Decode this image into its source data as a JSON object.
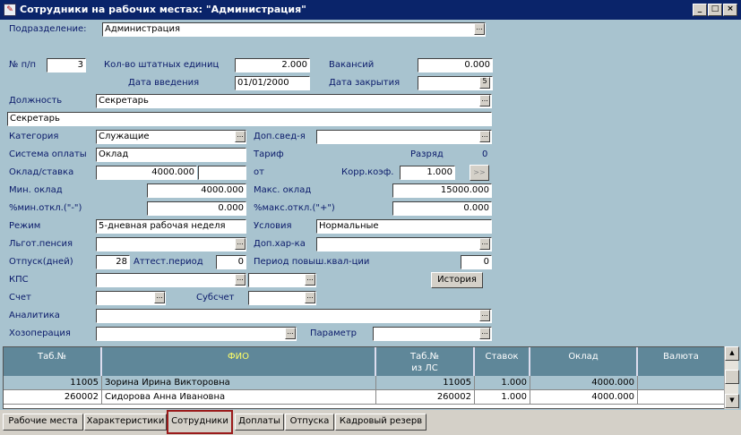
{
  "window": {
    "title": "Сотрудники на рабочих местах: \"Администрация\"",
    "icon": "app-icon",
    "min": "_",
    "max": "□",
    "close": "×"
  },
  "form": {
    "podrazdelenie": {
      "label": "Подразделение:",
      "value": "Администрация"
    },
    "num": {
      "label": "№ п/п",
      "value": "3"
    },
    "shtat": {
      "label": "Кол-во штатных единиц",
      "value": "2.000"
    },
    "vakansiy": {
      "label": "Вакансий",
      "value": "0.000"
    },
    "data_vvedeniya": {
      "label": "Дата введения",
      "value": "01/01/2000"
    },
    "data_zakrytiya": {
      "label": "Дата закрытия",
      "value": ""
    },
    "dolzhnost": {
      "label": "Должность",
      "value": "Секретарь",
      "full": "Секретарь"
    },
    "kategoriya": {
      "label": "Категория",
      "value": "Служащие"
    },
    "dop_sved": {
      "label": "Доп.свед-я",
      "value": ""
    },
    "sistema_oplaty": {
      "label": "Система оплаты",
      "value": "Оклад"
    },
    "tarif": {
      "label": "Тариф"
    },
    "razryad": {
      "label": "Разряд",
      "value": "0"
    },
    "oklad_stavka": {
      "label": "Оклад/ставка",
      "value": "4000.000",
      "value2": ""
    },
    "ot": {
      "label": "от"
    },
    "korr": {
      "label": "Корр.коэф.",
      "value": "1.000",
      "btn": ">>"
    },
    "min_oklad": {
      "label": "Мин. оклад",
      "value": "4000.000"
    },
    "maks_oklad": {
      "label": "Макс. оклад",
      "value": "15000.000"
    },
    "min_otkl": {
      "label": "%мин.откл.(\"-\")",
      "value": "0.000"
    },
    "maks_otkl": {
      "label": "%макс.откл.(\"+\")",
      "value": "0.000"
    },
    "rezhim": {
      "label": "Режим",
      "value": "5-дневная рабочая неделя"
    },
    "usloviya": {
      "label": "Условия",
      "value": "Нормальные"
    },
    "lgot_pensiya": {
      "label": "Льгот.пенсия",
      "value": ""
    },
    "dop_har": {
      "label": "Доп.хар-ка",
      "value": ""
    },
    "otpusk": {
      "label": "Отпуск(дней)",
      "value": "28"
    },
    "attest": {
      "label": "Аттест.период",
      "value": "0"
    },
    "period_povysh": {
      "label": "Период повыш.квал-ции",
      "value": "0"
    },
    "kps": {
      "label": "КПС",
      "value": "",
      "value2": ""
    },
    "istoriya": {
      "label": "История"
    },
    "schet": {
      "label": "Счет",
      "value": ""
    },
    "subschet": {
      "label": "Субсчет",
      "value": ""
    },
    "analitika": {
      "label": "Аналитика",
      "value": ""
    },
    "hozoperaciya": {
      "label": "Хозоперация",
      "value": ""
    },
    "parametr": {
      "label": "Параметр",
      "value": ""
    }
  },
  "grid": {
    "columns": [
      "Таб.№",
      "ФИО",
      "Таб.№ из ЛС",
      "Ставок",
      "Оклад",
      "Валюта"
    ],
    "col_tab_ls_line1": "Таб.№",
    "col_tab_ls_line2": "из ЛС",
    "rows": [
      {
        "tab": "11005",
        "fio": "Зорина Ирина Викторовна",
        "tab_ls": "11005",
        "stavok": "1.000",
        "oklad": "4000.000",
        "valuta": ""
      },
      {
        "tab": "260002",
        "fio": "Сидорова Анна Ивановна",
        "tab_ls": "260002",
        "stavok": "1.000",
        "oklad": "4000.000",
        "valuta": ""
      }
    ],
    "accent_fio": "#ffff66"
  },
  "tabs": [
    "Рабочие места",
    "Характеристики",
    "Сотрудники",
    "Доплаты",
    "Отпуска",
    "Кадровый резерв"
  ],
  "active_tab": "Сотрудники"
}
